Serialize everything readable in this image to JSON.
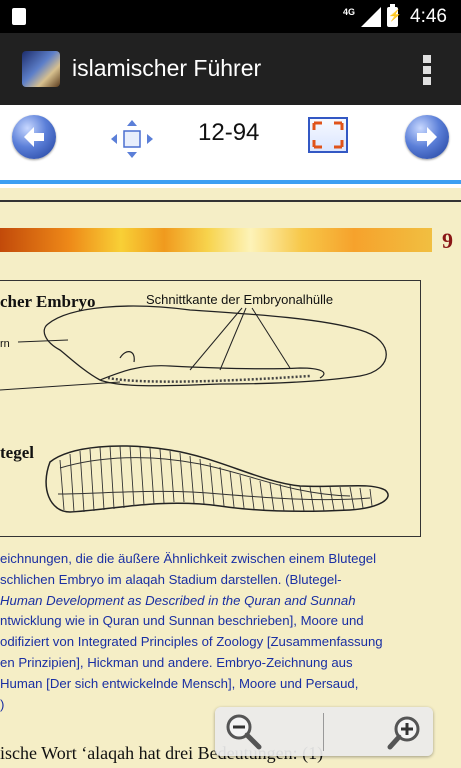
{
  "status_bar": {
    "network": "4G",
    "time": "4:46"
  },
  "app_bar": {
    "title": "islamischer Führer",
    "icon": "app-logo-icon"
  },
  "toolbar": {
    "page_indicator": "12-94",
    "prev_icon": "arrow-left-icon",
    "move_icon": "move-arrows-icon",
    "fullscreen_icon": "fullscreen-icon",
    "next_icon": "arrow-right-icon"
  },
  "document": {
    "page_number": "9",
    "figure": {
      "embryo_title": "cher Embryo",
      "embryo_label": "Schnittkante der Embryonalhülle",
      "embryo_side_label": "rn",
      "leech_title": "tegel"
    },
    "caption_lines": [
      "eichnungen, die die äußere Ähnlichkeit zwischen einem Blutegel",
      "schlichen Embryo im alaqah Stadium darstellen. (Blutegel-",
      "Human Development as Described in the Quran and Sunnah",
      "ntwicklung wie in Quran und Sunnan beschrieben], Moore und",
      "odifiziert von Integrated Principles of Zoology [Zusammenfassung",
      "en Prinzipien], Hickman und andere. Embryo-Zeichnung aus",
      "Human [Der sich entwickelnde Mensch], Moore und Persaud,",
      ")"
    ],
    "body_line": "ische Wort ‘alaqah hat drei Bedeutungen: (1)"
  },
  "zoom": {
    "zoom_out_icon": "zoom-out-icon",
    "zoom_in_icon": "zoom-in-icon"
  }
}
